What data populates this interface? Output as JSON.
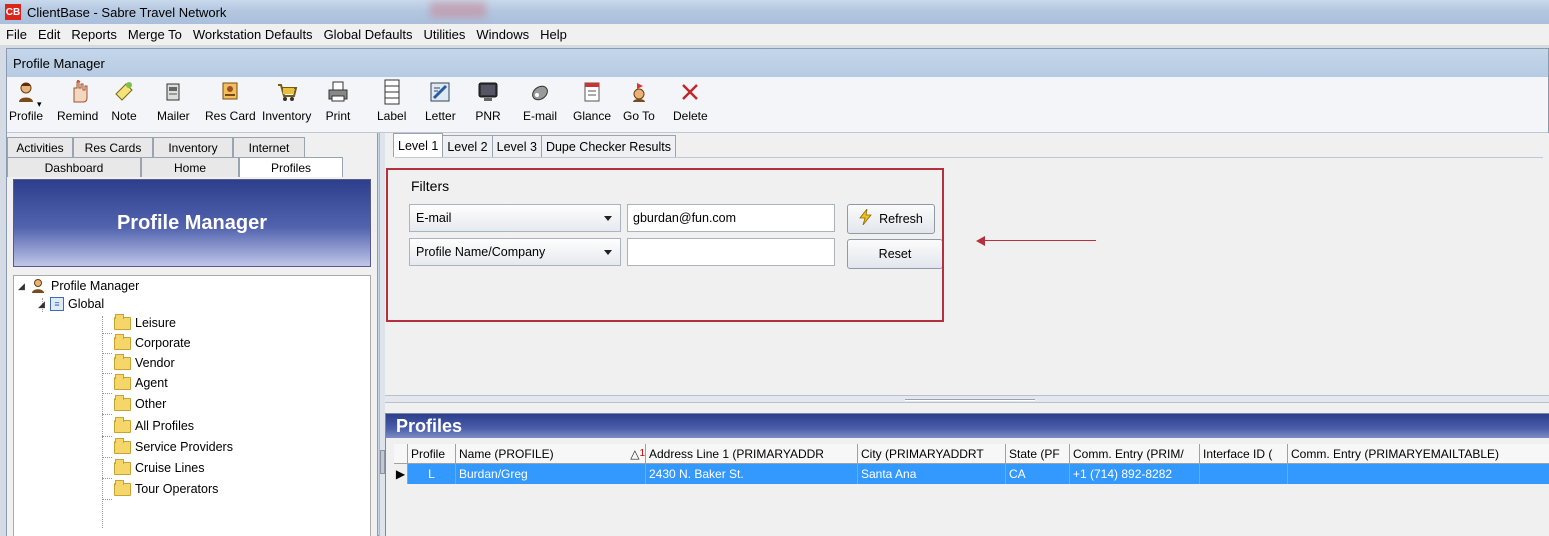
{
  "window": {
    "title": "ClientBase - Sabre Travel Network",
    "logo": "CB"
  },
  "menu": [
    "File",
    "Edit",
    "Reports",
    "Merge To",
    "Workstation Defaults",
    "Global Defaults",
    "Utilities",
    "Windows",
    "Help"
  ],
  "profile_manager": {
    "caption": "Profile Manager"
  },
  "toolbar": {
    "buttons": [
      {
        "label": "Profile",
        "icon": "person-icon"
      },
      {
        "label": "Remind",
        "icon": "hand-icon"
      },
      {
        "label": "Note",
        "icon": "note-icon"
      },
      {
        "label": "Mailer",
        "icon": "mailer-icon"
      },
      {
        "label": "Res Card",
        "icon": "res-card-icon"
      },
      {
        "label": "Inventory",
        "icon": "cart-icon"
      },
      {
        "label": "Print",
        "icon": "printer-icon"
      },
      {
        "label": "Label",
        "icon": "label-icon"
      },
      {
        "label": "Letter",
        "icon": "letter-icon"
      },
      {
        "label": "PNR",
        "icon": "monitor-icon"
      },
      {
        "label": "E-mail",
        "icon": "email-icon"
      },
      {
        "label": "Glance",
        "icon": "calendar-icon"
      },
      {
        "label": "Go To",
        "icon": "goto-icon"
      },
      {
        "label": "Delete",
        "icon": "delete-icon"
      }
    ]
  },
  "left_tabs": {
    "row1": [
      "Activities",
      "Res Cards",
      "Inventory",
      "Internet"
    ],
    "row2": [
      "Dashboard",
      "Home",
      "Profiles"
    ],
    "active": "Profiles"
  },
  "banner": {
    "title": "Profile Manager"
  },
  "tree": {
    "root": "Profile Manager",
    "global": "Global",
    "folders": [
      "Leisure",
      "Corporate",
      "Vendor",
      "Agent",
      "Other",
      "All Profiles",
      "Service Providers",
      "Cruise Lines",
      "Tour Operators"
    ]
  },
  "right_tabs": [
    "Level 1",
    "Level 2",
    "Level 3",
    "Dupe Checker Results"
  ],
  "filters": {
    "legend": "Filters",
    "filter1_field": "E-mail",
    "filter1_value": "gburdan@fun.com",
    "filter2_field": "Profile Name/Company",
    "filter2_value": "",
    "refresh_label": "Refresh",
    "reset_label": "Reset"
  },
  "profiles": {
    "header": "Profiles",
    "columns": [
      "Profile",
      "Name  (PROFILE)",
      "Address Line 1  (PRIMARYADDR",
      "City  (PRIMARYADDRT",
      "State  (PF",
      "Comm. Entry  (PRIM/",
      "Interface ID  (",
      "Comm. Entry  (PRIMARYEMAILTABLE)"
    ],
    "sort_marker": "△",
    "sort_index": "1",
    "rows": [
      [
        "L",
        "Burdan/Greg",
        "2430 N. Baker St.",
        "Santa Ana",
        "CA",
        "+1 (714) 892-8282",
        "",
        ""
      ]
    ]
  },
  "colors": {
    "accent_red": "#b5303c",
    "selection": "#3399ff",
    "banner": "#2d3f8c"
  }
}
